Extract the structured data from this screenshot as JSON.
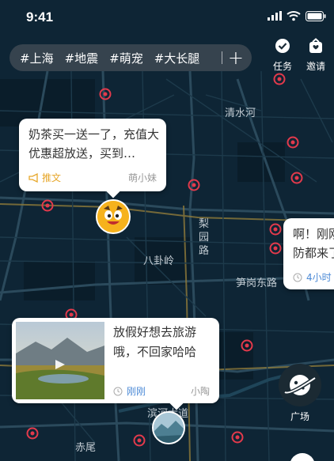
{
  "status": {
    "time": "9:41"
  },
  "topics": [
    "#上海",
    "#地震",
    "#萌宠",
    "#大长腿"
  ],
  "topic_add": "+",
  "actions": {
    "task": "任务",
    "invite": "邀请",
    "plaza": "广场"
  },
  "cards": [
    {
      "text": "奶茶买一送一了，充值大优惠超放送，买到…",
      "type": "推文",
      "author": "萌小妹"
    },
    {
      "line1": "啊！刚刚",
      "line2": "防都来了",
      "time": "4小时"
    },
    {
      "line1": "放假好想去旅游",
      "line2": "哦，不回家哈哈",
      "time": "刚刚",
      "author": "小陶"
    }
  ],
  "map": {
    "labels": [
      "清水河",
      "八卦岭",
      "笋岗东路",
      "滨河大道",
      "赤尾"
    ],
    "vertical_label": [
      "梨",
      "园",
      "路"
    ]
  },
  "colors": {
    "map_background": "#0e2535",
    "marker": "#e33a4c",
    "accent_blue": "#4c8ad6",
    "accent_orange": "#e7a72a"
  },
  "icons": [
    "signal-icon",
    "wifi-icon",
    "battery-icon",
    "task-check-icon",
    "invite-gift-icon",
    "megaphone-icon",
    "clock-icon",
    "planet-icon"
  ]
}
